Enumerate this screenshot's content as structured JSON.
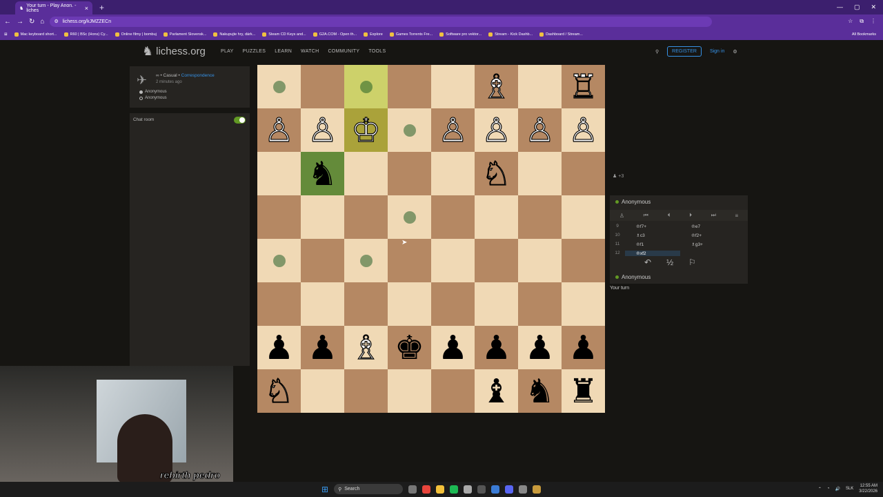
{
  "browser": {
    "tab_title": "Your turn - Play Anon. - liches",
    "url": "lichess.org/kJMZZECn",
    "bookmarks": [
      "Mac keyboard short...",
      "R60 | BSc (Hons) Cy...",
      "Online filmy | bombuj",
      "Parlament Slovensk...",
      "Nakupujte hry, dárk...",
      "Steam CD Keys and...",
      "G2A.COM - Open th...",
      "Explore",
      "Games Torrents Fre...",
      "Software pro vektor...",
      "Stream - Kick Dashb...",
      "Dashboard / Stream..."
    ],
    "all_bookmarks": "All Bookmarks"
  },
  "site": {
    "logo": "lichess.org",
    "nav": [
      "PLAY",
      "PUZZLES",
      "LEARN",
      "WATCH",
      "COMMUNITY",
      "TOOLS"
    ],
    "register": "REGISTER",
    "signin": "Sign in"
  },
  "game": {
    "mode": "∞ • Casual •",
    "type": "Correspondence",
    "ago": "2 minutes ago",
    "player_white": "Anonymous",
    "player_black": "Anonymous",
    "chat_label": "Chat room"
  },
  "board": {
    "rows": [
      [
        {
          "p": "",
          "c": "l",
          "dot": true
        },
        {
          "p": "",
          "c": "d"
        },
        {
          "p": "",
          "c": "hl-l",
          "dot": true
        },
        {
          "p": "",
          "c": "d"
        },
        {
          "p": "",
          "c": "l"
        },
        {
          "p": "♗",
          "c": "d",
          "w": true
        },
        {
          "p": "",
          "c": "l"
        },
        {
          "p": "♖",
          "c": "d",
          "w": true
        }
      ],
      [
        {
          "p": "♙",
          "c": "d",
          "w": true
        },
        {
          "p": "♙",
          "c": "l",
          "w": true
        },
        {
          "p": "♔",
          "c": "hl-d",
          "w": true
        },
        {
          "p": "",
          "c": "l",
          "dot": true
        },
        {
          "p": "♙",
          "c": "d",
          "w": true
        },
        {
          "p": "♙",
          "c": "l",
          "w": true
        },
        {
          "p": "♙",
          "c": "d",
          "w": true
        },
        {
          "p": "♙",
          "c": "l",
          "w": true
        }
      ],
      [
        {
          "p": "",
          "c": "l"
        },
        {
          "p": "♞",
          "c": "sel"
        },
        {
          "p": "",
          "c": "l"
        },
        {
          "p": "",
          "c": "d"
        },
        {
          "p": "",
          "c": "l"
        },
        {
          "p": "♘",
          "c": "d",
          "w": true
        },
        {
          "p": "",
          "c": "l"
        },
        {
          "p": "",
          "c": "d"
        }
      ],
      [
        {
          "p": "",
          "c": "d"
        },
        {
          "p": "",
          "c": "l"
        },
        {
          "p": "",
          "c": "d"
        },
        {
          "p": "",
          "c": "l",
          "dot": true
        },
        {
          "p": "",
          "c": "d"
        },
        {
          "p": "",
          "c": "l"
        },
        {
          "p": "",
          "c": "d"
        },
        {
          "p": "",
          "c": "l"
        }
      ],
      [
        {
          "p": "",
          "c": "l",
          "dot": true
        },
        {
          "p": "",
          "c": "d"
        },
        {
          "p": "",
          "c": "l",
          "dot": true
        },
        {
          "p": "",
          "c": "d"
        },
        {
          "p": "",
          "c": "l"
        },
        {
          "p": "",
          "c": "d"
        },
        {
          "p": "",
          "c": "l"
        },
        {
          "p": "",
          "c": "d"
        }
      ],
      [
        {
          "p": "",
          "c": "d"
        },
        {
          "p": "",
          "c": "l"
        },
        {
          "p": "",
          "c": "d"
        },
        {
          "p": "",
          "c": "l"
        },
        {
          "p": "",
          "c": "d"
        },
        {
          "p": "",
          "c": "l"
        },
        {
          "p": "",
          "c": "d"
        },
        {
          "p": "",
          "c": "l"
        }
      ],
      [
        {
          "p": "♟",
          "c": "l"
        },
        {
          "p": "♟",
          "c": "d"
        },
        {
          "p": "♗",
          "c": "l",
          "w": true
        },
        {
          "p": "♚",
          "c": "d"
        },
        {
          "p": "♟",
          "c": "l"
        },
        {
          "p": "♟",
          "c": "d"
        },
        {
          "p": "♟",
          "c": "l"
        },
        {
          "p": "♟",
          "c": "d"
        }
      ],
      [
        {
          "p": "♘",
          "c": "d",
          "w": true
        },
        {
          "p": "",
          "c": "l"
        },
        {
          "p": "",
          "c": "d"
        },
        {
          "p": "",
          "c": "l"
        },
        {
          "p": "",
          "c": "d"
        },
        {
          "p": "♝",
          "c": "l"
        },
        {
          "p": "♞",
          "c": "d"
        },
        {
          "p": "♜",
          "c": "l"
        }
      ]
    ]
  },
  "material": "+3",
  "panel": {
    "top_player": "Anonymous",
    "bottom_player": "Anonymous",
    "moves": [
      {
        "n": "9",
        "w": "♔f7+",
        "b": "♔e7"
      },
      {
        "n": "10",
        "w": "♗c3",
        "b": "♔f2+"
      },
      {
        "n": "11",
        "w": "♔f1",
        "b": "♗g3+"
      },
      {
        "n": "12",
        "w": "♔xf2",
        "b": ""
      }
    ],
    "actions": [
      "↶",
      "½",
      "⚐"
    ],
    "your_turn": "Your turn"
  },
  "stream": {
    "label": "rebirth pedro"
  },
  "taskbar": {
    "search": "Search",
    "lang": "SLK",
    "time": "12:55 AM",
    "date": "3/22/2026"
  }
}
